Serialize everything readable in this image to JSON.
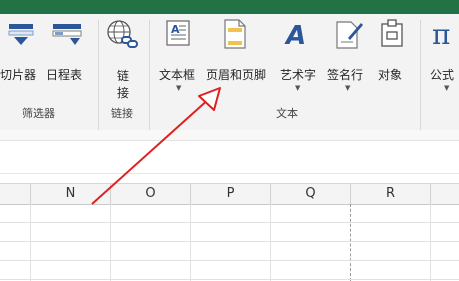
{
  "ribbon": {
    "commands": {
      "slicer": "切片器",
      "timeline": "日程表",
      "link": "链接",
      "textbox": "文本框",
      "header_footer": "页眉和页脚",
      "wordart": "艺术字",
      "signature_line": "签名行",
      "object": "对象",
      "equation": "公式"
    },
    "groups": {
      "filters": "筛选器",
      "links": "链接",
      "text": "文本"
    },
    "colors": {
      "titlebar": "#217346",
      "icon_blue": "#2b579a",
      "arrow_red": "#e02020"
    }
  },
  "sheet": {
    "columns": [
      "N",
      "O",
      "P",
      "Q",
      "R"
    ]
  }
}
